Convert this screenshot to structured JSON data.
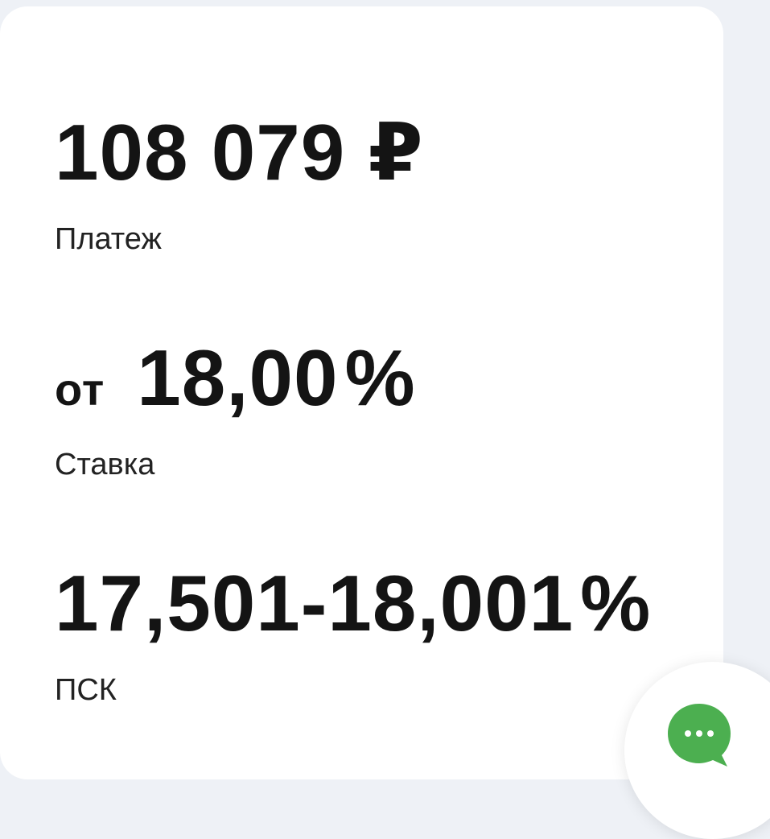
{
  "stats": {
    "payment": {
      "value": "108 079 ₽",
      "label": "Платеж"
    },
    "rate": {
      "prefix": "от",
      "value": "18,00",
      "percent": "%",
      "label": "Ставка"
    },
    "psk": {
      "value": "17,501-18,001",
      "percent": "%",
      "label": "ПСК"
    }
  },
  "chat_button": {
    "icon": "chat-bubble-icon",
    "color": "#4caf50"
  },
  "colors": {
    "background": "#eef1f6",
    "card": "#ffffff",
    "text": "#141414"
  }
}
